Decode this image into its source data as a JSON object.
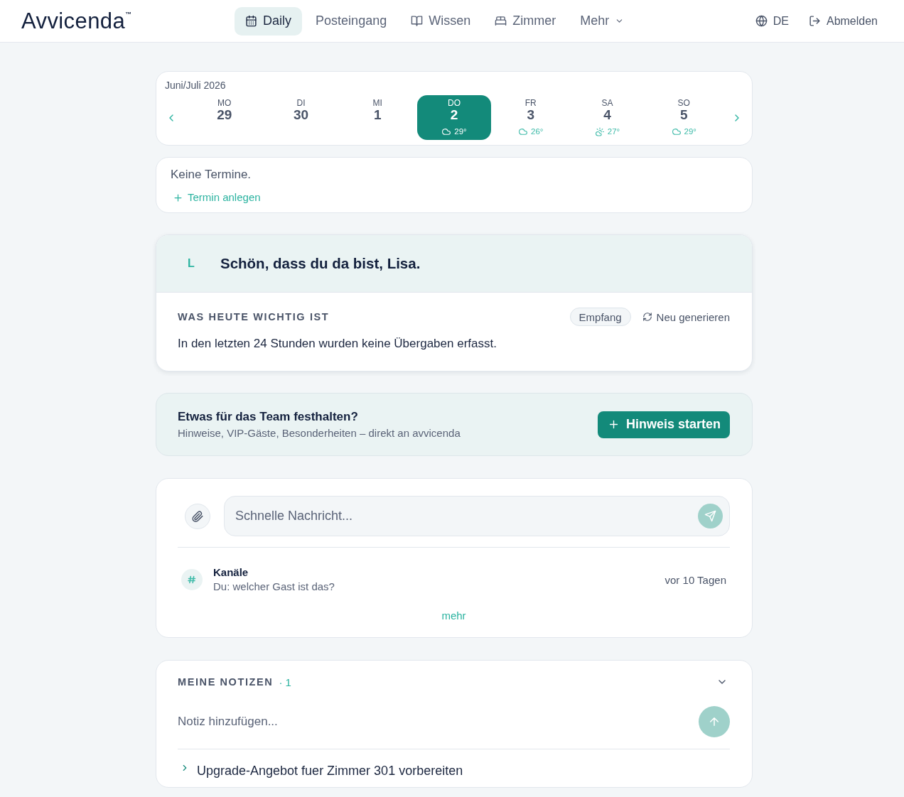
{
  "header": {
    "logo": "Avvicenda$^{™}$",
    "nav": [
      {
        "label": "Daily",
        "kind": "calendar",
        "selected": true
      },
      {
        "label": "Posteingang",
        "kind": "text",
        "selected": false
      },
      {
        "label": "Wissen",
        "kind": "book",
        "selected": false
      },
      {
        "label": "Zimmer",
        "kind": "bed",
        "selected": false
      },
      {
        "label": "Mehr",
        "kind": "dropdown",
        "selected": false
      }
    ],
    "language": "DE",
    "logout": "Abmelden"
  },
  "calendar": {
    "month": "Juni/Juli 2026",
    "days": [
      {
        "weekday": "MO",
        "date": "29",
        "selected": false
      },
      {
        "weekday": "DI",
        "date": "30",
        "selected": false
      },
      {
        "weekday": "MI",
        "date": "1",
        "selected": false
      },
      {
        "weekday": "DO",
        "date": "2",
        "selected": true,
        "weather": {
          "kind": "cloud",
          "temp": "29°"
        }
      },
      {
        "weekday": "FR",
        "date": "3",
        "selected": false,
        "weather": {
          "kind": "cloud",
          "temp": "26°"
        }
      },
      {
        "weekday": "SA",
        "date": "4",
        "selected": false,
        "weather": {
          "kind": "sun-cloud",
          "temp": "27°"
        }
      },
      {
        "weekday": "SO",
        "date": "5",
        "selected": false,
        "weather": {
          "kind": "cloud",
          "temp": "29°"
        }
      }
    ]
  },
  "appointments": {
    "empty_text": "Keine Termine.",
    "add_label": "Termin anlegen"
  },
  "greeting": {
    "initial": "L",
    "title": "Schön, dass du da bist, Lisa.",
    "section_label": "WAS HEUTE WICHTIG IST",
    "tag": "Empfang",
    "regenerate": "Neu generieren",
    "summary": "In den letzten 24 Stunden wurden keine Übergaben erfasst."
  },
  "hint": {
    "title": "Etwas für das Team festhalten?",
    "subtitle": "Hinweise, VIP-Gäste, Besonderheiten – direkt an avvicenda",
    "button": "Hinweis starten"
  },
  "messages": {
    "placeholder": "Schnelle Nachricht...",
    "send_disabled": true,
    "channels": [
      {
        "name": "Kanäle",
        "preview": "Du: welcher Gast ist das?",
        "time": "vor 10 Tagen"
      }
    ],
    "more": "mehr"
  },
  "notes": {
    "title": "MEINE NOTIZEN",
    "count": "· 1",
    "expanded": true,
    "placeholder": "Notiz hinzufügen...",
    "send_disabled": true,
    "items": [
      {
        "text": "Upgrade-Angebot fuer Zimmer 301 vorbereiten",
        "expanded": false
      }
    ]
  }
}
